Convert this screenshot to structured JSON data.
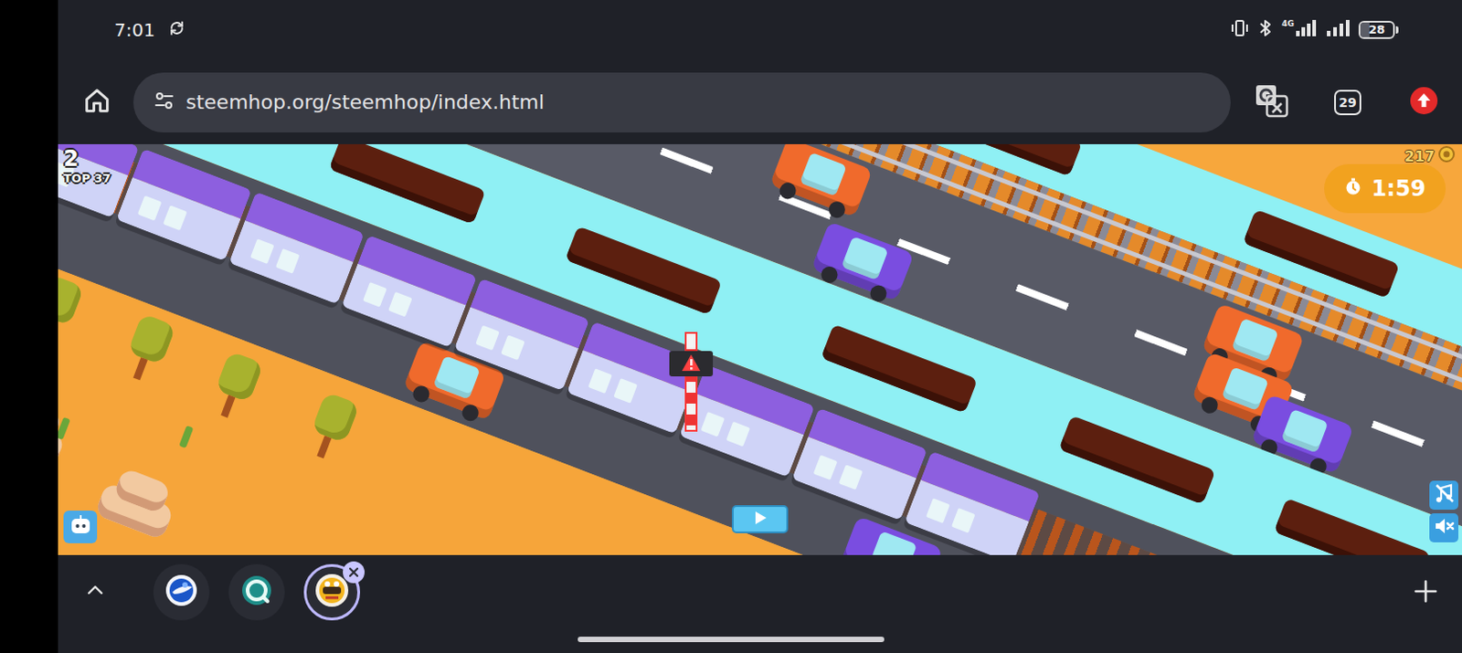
{
  "status_bar": {
    "time": "7:01",
    "network": "4G",
    "battery": "28",
    "battery_level": 0.28
  },
  "browser": {
    "url": "steemhop.org/steemhop/index.html",
    "tab_count": "29"
  },
  "game": {
    "score": "2",
    "rank": "TOP 37",
    "coins": "217",
    "timer": "1:59",
    "music_muted": true,
    "sound_muted": true
  },
  "tab_strip": {
    "tabs": [
      {
        "selected": false
      },
      {
        "selected": false
      },
      {
        "selected": true
      }
    ]
  }
}
